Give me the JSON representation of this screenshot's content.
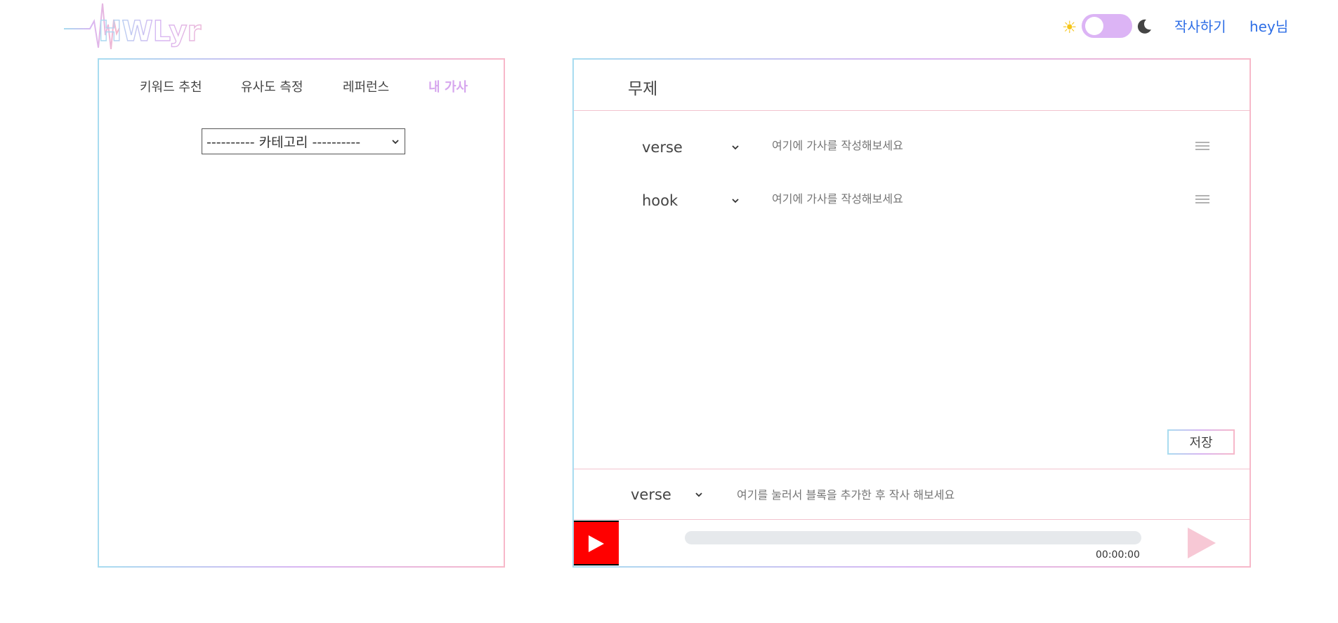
{
  "header": {
    "logo_text": "HWLyric",
    "nav": {
      "write": "작사하기",
      "user": "hey님"
    },
    "theme": {
      "mode": "light",
      "toggle_color": "#dcb4f5",
      "sun_color": "#f5c518",
      "moon_color": "#444444"
    }
  },
  "left_panel": {
    "tabs": [
      {
        "label": "키워드 추천",
        "active": false
      },
      {
        "label": "유사도 측정",
        "active": false
      },
      {
        "label": "레퍼런스",
        "active": false
      },
      {
        "label": "내 가사",
        "active": true
      }
    ],
    "active_tab_color": "#d6a6ee",
    "category_select": {
      "selected": "---------- 카테고리 ----------"
    }
  },
  "editor": {
    "title": "무제",
    "rows": [
      {
        "part": "verse",
        "placeholder": "여기에 가사를 작성해보세요"
      },
      {
        "part": "hook",
        "placeholder": "여기에 가사를 작성해보세요"
      }
    ],
    "save_label": "저장",
    "add_block": {
      "part": "verse",
      "placeholder": "여기를 눌러서 블록을 추가한 후 작사 해보세요"
    }
  },
  "player": {
    "time": "00:00:00",
    "progress": 0,
    "play_color": "#f7c8d5",
    "youtube_color": "#ff0000"
  },
  "border_gradient": [
    "#a8dcf0",
    "#d9b6f2",
    "#f7b8c9"
  ]
}
